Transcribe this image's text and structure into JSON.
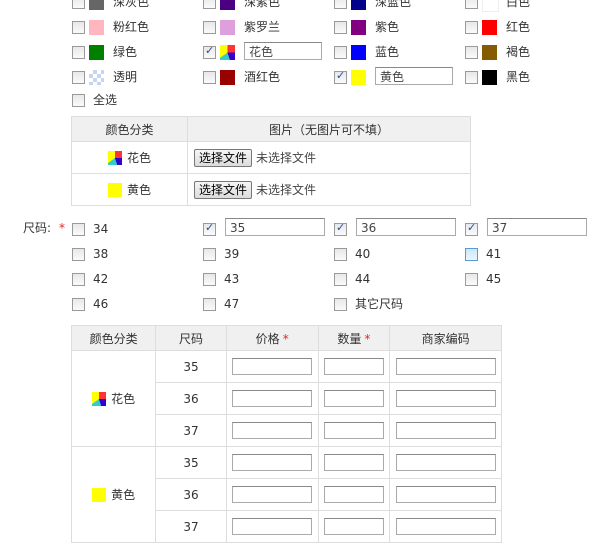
{
  "colors": [
    {
      "label": "深灰色",
      "swatch": "#666666",
      "checked": false
    },
    {
      "label": "深紫色",
      "swatch": "#4b0082",
      "checked": false
    },
    {
      "label": "深蓝色",
      "swatch": "#00008b",
      "checked": false
    },
    {
      "label": "白色",
      "swatch": "#ffffff",
      "checked": false
    },
    {
      "label": "粉红色",
      "swatch": "#ffb6c1",
      "checked": false
    },
    {
      "label": "紫罗兰",
      "swatch": "#dda0dd",
      "checked": false
    },
    {
      "label": "紫色",
      "swatch": "#800080",
      "checked": false
    },
    {
      "label": "红色",
      "swatch": "#ff0000",
      "checked": false
    },
    {
      "label": "绿色",
      "swatch": "#008000",
      "checked": false
    },
    {
      "label": "花色",
      "swatch": "flower",
      "checked": true,
      "value": "花色"
    },
    {
      "label": "蓝色",
      "swatch": "#0000ff",
      "checked": false
    },
    {
      "label": "褐色",
      "swatch": "#855b00",
      "checked": false
    },
    {
      "label": "透明",
      "swatch": "transparent",
      "checked": false
    },
    {
      "label": "酒红色",
      "swatch": "#990000",
      "checked": false
    },
    {
      "label": "黄色",
      "swatch": "#ffff00",
      "checked": true,
      "value": "黄色"
    },
    {
      "label": "黑色",
      "swatch": "#000000",
      "checked": false
    }
  ],
  "select_all": "全选",
  "color_table": {
    "headers": [
      "颜色分类",
      "图片（无图片可不填）"
    ],
    "rows": [
      {
        "name": "花色",
        "swatch": "flower"
      },
      {
        "name": "黄色",
        "swatch": "#ffff00"
      }
    ],
    "button": "选择文件",
    "no_file": "未选择文件"
  },
  "size_label": "尺码:",
  "required_mark": "*",
  "sizes": [
    {
      "label": "34",
      "checked": false
    },
    {
      "label": "35",
      "checked": true,
      "value": "35"
    },
    {
      "label": "36",
      "checked": true,
      "value": "36"
    },
    {
      "label": "37",
      "checked": true,
      "value": "37"
    },
    {
      "label": "38",
      "checked": false
    },
    {
      "label": "39",
      "checked": false
    },
    {
      "label": "40",
      "checked": false
    },
    {
      "label": "41",
      "checked": false,
      "hover": true
    },
    {
      "label": "42",
      "checked": false
    },
    {
      "label": "43",
      "checked": false
    },
    {
      "label": "44",
      "checked": false
    },
    {
      "label": "45",
      "checked": false
    },
    {
      "label": "46",
      "checked": false
    },
    {
      "label": "47",
      "checked": false
    },
    {
      "label": "其它尺码",
      "checked": false
    }
  ],
  "sku_table": {
    "headers": [
      "颜色分类",
      "尺码",
      "价格",
      "数量",
      "商家编码"
    ],
    "required": [
      false,
      false,
      true,
      true,
      false
    ],
    "groups": [
      {
        "color": "花色",
        "swatch": "flower",
        "sizes": [
          "35",
          "36",
          "37"
        ]
      },
      {
        "color": "黄色",
        "swatch": "#ffff00",
        "sizes": [
          "35",
          "36",
          "37"
        ]
      }
    ]
  }
}
